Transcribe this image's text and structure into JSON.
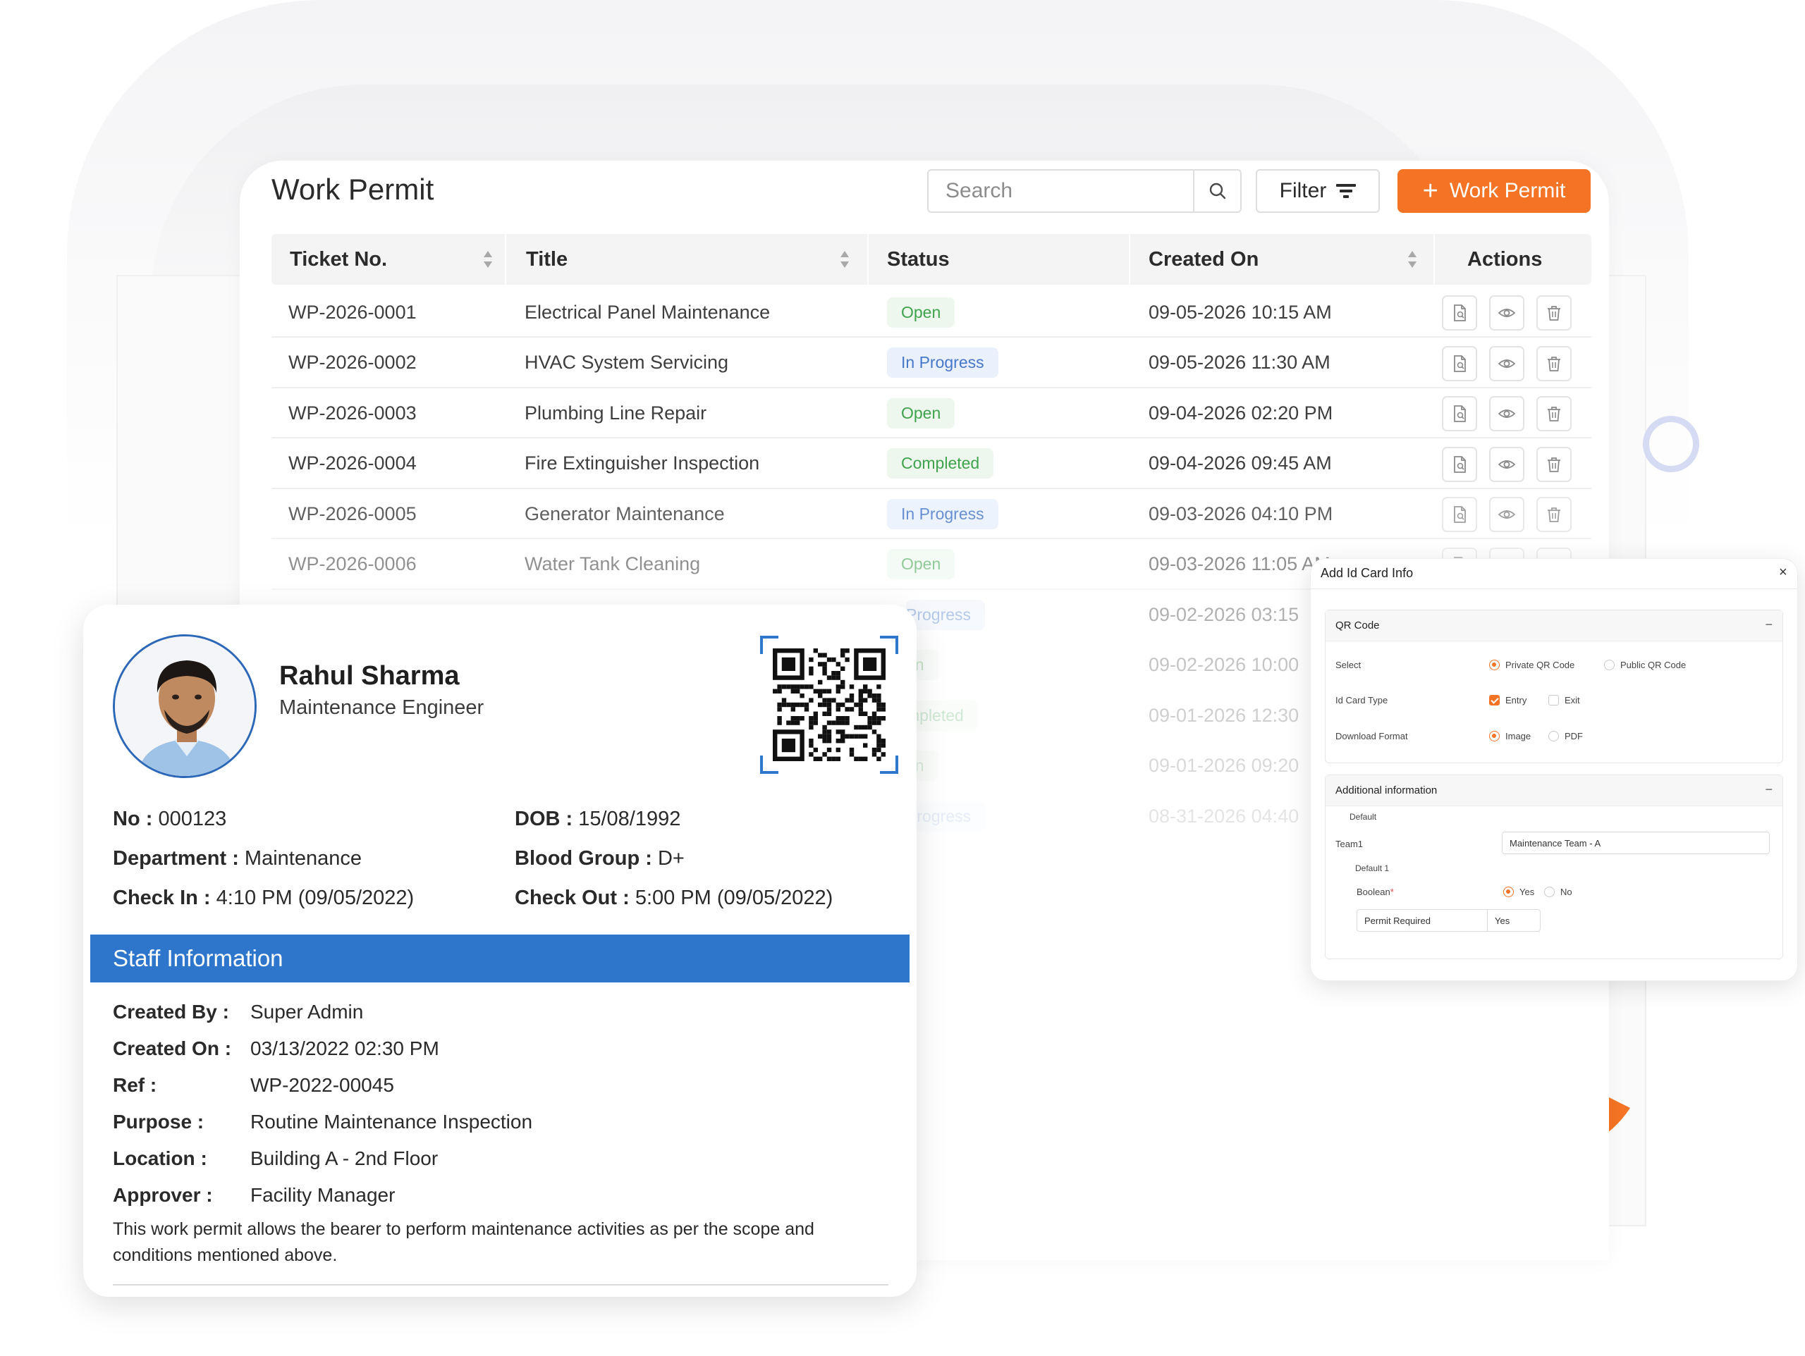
{
  "colors": {
    "accent": "#f47324",
    "staff_bar": "#2e76cc",
    "open_badge": "#3fa34d",
    "progress_badge": "#4677c9"
  },
  "page": {
    "title": "Work Permit",
    "search_placeholder": "Search",
    "filter_label": "Filter",
    "add_button_label": "Work Permit",
    "add_button_icon": "plus-icon"
  },
  "table": {
    "columns": [
      "Ticket No.",
      "Title",
      "Status",
      "Created On",
      "Actions"
    ],
    "rows": [
      {
        "ticket": "WP-2026-0001",
        "title": "Electrical Panel Maintenance",
        "status": "Open",
        "created": "09-05-2026 10:15 AM"
      },
      {
        "ticket": "WP-2026-0002",
        "title": "HVAC System Servicing",
        "status": "In Progress",
        "created": "09-05-2026 11:30 AM"
      },
      {
        "ticket": "WP-2026-0003",
        "title": "Plumbing Line Repair",
        "status": "Open",
        "created": "09-04-2026 02:20 PM"
      },
      {
        "ticket": "WP-2026-0004",
        "title": "Fire Extinguisher Inspection",
        "status": "Completed",
        "created": "09-04-2026 09:45 AM"
      },
      {
        "ticket": "WP-2026-0005",
        "title": "Generator Maintenance",
        "status": "In Progress",
        "created": "09-03-2026 04:10 PM"
      },
      {
        "ticket": "WP-2026-0006",
        "title": "Water Tank Cleaning",
        "status": "Open",
        "created": "09-03-2026 11:05 AM"
      }
    ],
    "partial_rows": [
      {
        "status": "Progress",
        "created": "09-02-2026 03:15"
      },
      {
        "status": "en",
        "created": "09-02-2026 10:00"
      },
      {
        "status": "mpleted",
        "created": "09-01-2026 12:30"
      },
      {
        "status": "en",
        "created": "09-01-2026 09:20"
      },
      {
        "status": "Progress",
        "created": "08-31-2026 04:40"
      }
    ],
    "action_icons": [
      "document-icon",
      "eye-icon",
      "trash-icon"
    ]
  },
  "id_card": {
    "name": "Rahul Sharma",
    "role": "Maintenance Engineer",
    "no_label": "No :",
    "no_value": "000123",
    "dob_label": "DOB :",
    "dob_value": "15/08/1992",
    "dept_label": "Department :",
    "dept_value": "Maintenance",
    "blood_label": "Blood Group :",
    "blood_value": "D+",
    "checkin_label": "Check In :",
    "checkin_value": "4:10 PM (09/05/2022)",
    "checkout_label": "Check Out :",
    "checkout_value": "5:00 PM (09/05/2022)",
    "staff_title": "Staff Information",
    "staff": [
      {
        "label": "Created By",
        "sep": ":",
        "value": "Super Admin"
      },
      {
        "label": "Created On",
        "sep": ":",
        "value": "03/13/2022 02:30 PM"
      },
      {
        "label": "Ref :",
        "sep": "",
        "value": "WP-2022-00045"
      },
      {
        "label": "Purpose :",
        "sep": "",
        "value": "Routine Maintenance Inspection"
      },
      {
        "label": "Location :",
        "sep": "",
        "value": "Building A - 2nd Floor"
      },
      {
        "label": "Approver :",
        "sep": "",
        "value": "Facility Manager"
      }
    ],
    "note": "This work permit allows the bearer to perform maintenance activities as per the scope and conditions mentioned above."
  },
  "dialog": {
    "title": "Add Id Card Info",
    "close": "×",
    "qr_section": {
      "title": "QR Code",
      "toggle": "−",
      "select_label": "Select",
      "select_options": [
        "Private QR Code",
        "Public QR Code"
      ],
      "idtype_label": "Id Card Type",
      "idtype_options": [
        "Entry",
        "Exit"
      ],
      "download_label": "Download Format",
      "download_options": [
        "Image",
        "PDF"
      ]
    },
    "additional_section": {
      "title": "Additional information",
      "toggle": "−",
      "default_label": "Default",
      "team_label": "Team1",
      "team_value": "Maintenance Team - A",
      "default1_label": "Default 1",
      "boolean_label": "Boolean",
      "boolean_required": "*",
      "boolean_options": [
        "Yes",
        "No"
      ],
      "permit_label": "Permit Required",
      "permit_value": "Yes"
    }
  }
}
